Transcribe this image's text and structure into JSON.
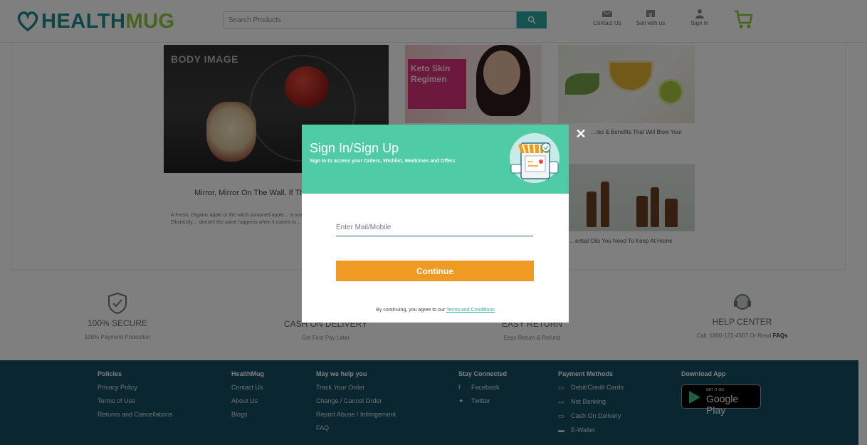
{
  "header": {
    "logo_part1": "HEALTH",
    "logo_part2": "MUG",
    "search_placeholder": "Search Products",
    "nav": [
      {
        "label": "Contact Us",
        "icon": "mail-icon"
      },
      {
        "label": "Sell with us",
        "icon": "store-icon"
      },
      {
        "label": "Sign In",
        "icon": "user-icon"
      }
    ],
    "cart_icon": "cart-icon"
  },
  "articles": {
    "main_image_text": "BODY IMAGE",
    "main_title": "Mirror, Mirror On The Wall, If Thy… Them ALL?",
    "main_desc": "A Fresh, Organic apple or the witch poisoned apple… a snack? Which would you prefer? Obviously… doesn't the same happens when it comes to…",
    "promo_text": "Keto Skin Regimen",
    "right_caption_1": "…ies & Benefits That Will Blow Your",
    "right_caption_2": "…ential Oils You Need To Keep At Home"
  },
  "features": [
    {
      "title": "100% SECURE",
      "sub": "100% Payment Protection"
    },
    {
      "title": "CASH ON DELIVERY",
      "sub": "Get First Pay Later"
    },
    {
      "title": "EASY RETURN",
      "sub": "Easy Return & Refund"
    },
    {
      "title": "HELP CENTER",
      "sub": "Call: 1800-123-4567 Or Read",
      "sub_bold": "FAQs"
    }
  ],
  "footer": {
    "cols": [
      {
        "heading": "Policies",
        "links": [
          "Privacy Policy",
          "Terms of Use",
          "Returns and Cancellations"
        ]
      },
      {
        "heading": "HealthMug",
        "links": [
          "Contact Us",
          "About Us",
          "Blogs"
        ]
      },
      {
        "heading": "May we help you",
        "links": [
          "Track Your Order",
          "Change / Cancel Order",
          "Report Abuse / Infringement",
          "FAQ"
        ]
      },
      {
        "heading": "Stay Connected",
        "links": [
          "Facebook",
          "Twitter"
        ]
      },
      {
        "heading": "Payment Methods",
        "links": [
          "Debit/Credit Cards",
          "Net Banking",
          "Cash On Delivery",
          "E-Wallet"
        ]
      },
      {
        "heading": "Download App",
        "links": []
      }
    ],
    "gplay_small": "GET IT ON",
    "gplay_big": "Google Play"
  },
  "modal": {
    "title": "Sign In/Sign Up",
    "subtitle": "Sign in to access your Orders, Wishlist, Medicines and Offers",
    "input_placeholder": "Enter Mail/Mobile",
    "input_value": "",
    "continue_label": "Continue",
    "terms_prefix": "By continuing, you agree to our",
    "terms_link": "Terms and Conditions",
    "close_label": "✕"
  },
  "colors": {
    "modal_header": "#4fcba6",
    "continue_button": "#ee9a23",
    "footer_bg": "#144f63",
    "brand_teal": "#1d8a8a",
    "brand_green": "#8dc63f"
  }
}
